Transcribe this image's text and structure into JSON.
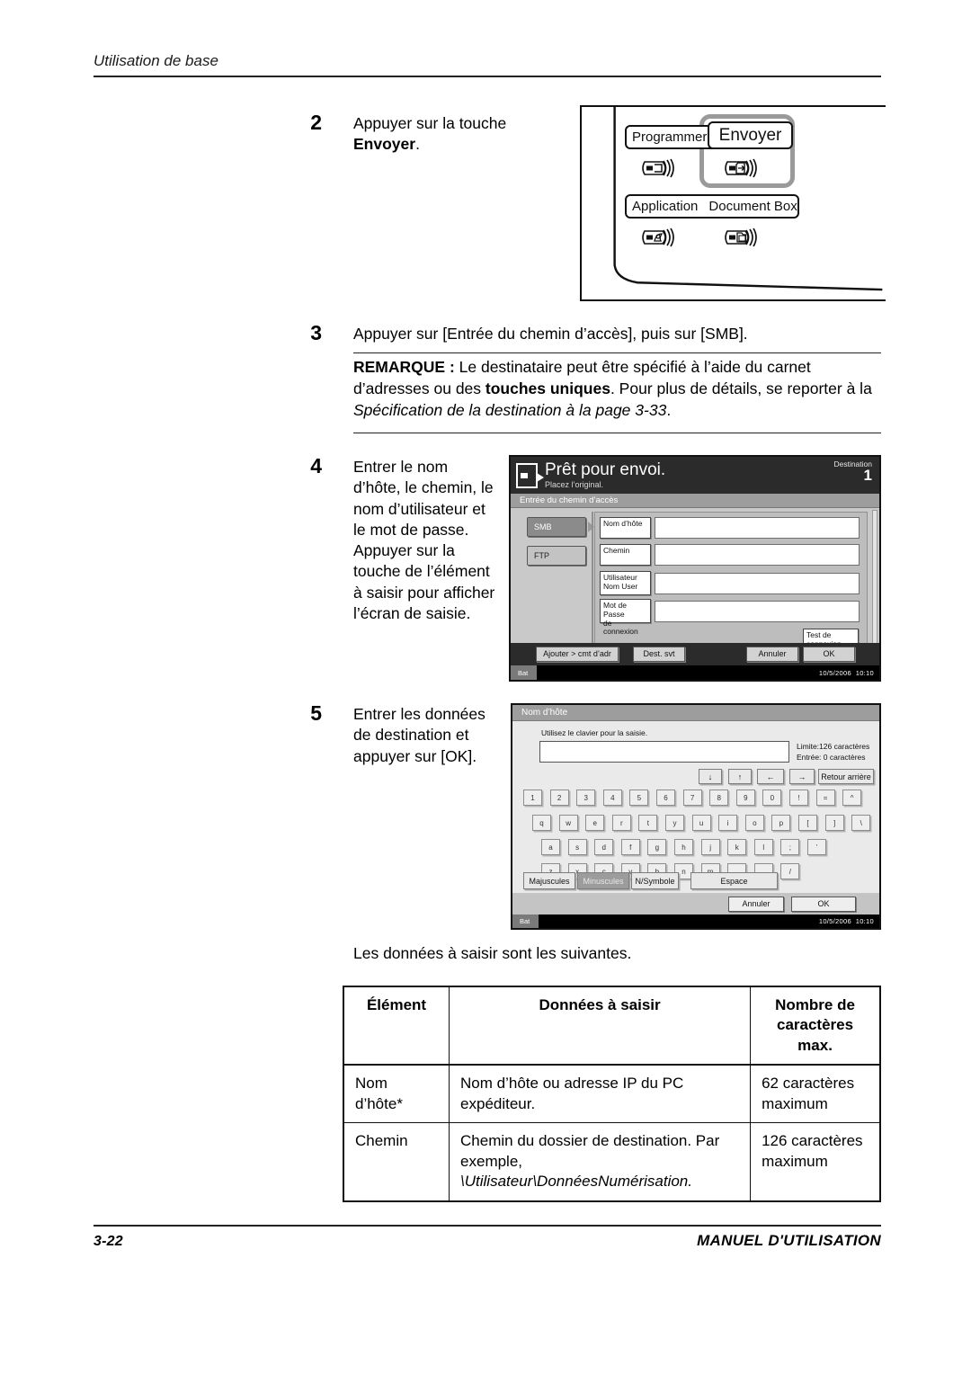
{
  "page": {
    "running_head": "Utilisation de base",
    "folio": "3-22",
    "manual_name": "MANUEL D'UTILISATION"
  },
  "steps": [
    {
      "number": "2",
      "line1": "Appuyer sur la touche",
      "line2_bold": "Envoyer",
      "line2_tail": "."
    },
    {
      "number": "3",
      "text": "Appuyer sur [Entrée du chemin d’accès], puis sur [SMB]."
    },
    {
      "number": "4",
      "text": "Entrer le nom d’hôte, le chemin, le nom d’utilisateur et le mot de passe. Appuyer sur la touche de l’élément à saisir pour afficher l’écran de saisie."
    },
    {
      "number": "5",
      "text": "Entrer les données de destination et appuyer sur [OK]."
    }
  ],
  "note": {
    "label": "REMARQUE :",
    "part1": " Le destinataire peut être spécifié à l’aide du carnet d’adresses ou des ",
    "bold1": "touches uniques",
    "part2": ". Pour plus de détails, se reporter à la ",
    "italic1": "Spécification de la destination à la page 3-33",
    "part3": "."
  },
  "op_panel": {
    "keys": [
      {
        "label": "Programmer",
        "icon": "program-key-icon"
      },
      {
        "label": "Envoyer",
        "icon": "send-key-icon"
      },
      {
        "label": "Application",
        "icon": "application-key-icon"
      },
      {
        "label": "Document Box",
        "icon": "document-box-key-icon"
      }
    ],
    "highlight": "Envoyer"
  },
  "screen_path": {
    "title": "Prêt pour envoi.",
    "subtitle": "Placez l’original.",
    "destination_label": "Destination",
    "destination_count": "1",
    "tabbar": "Entrée du chemin d’accès",
    "protocol_tabs": [
      {
        "label": "SMB",
        "selected": true
      },
      {
        "label": "FTP",
        "selected": false
      }
    ],
    "fields": [
      {
        "key_line1": "Nom d’hôte",
        "key_line2": "",
        "value": ""
      },
      {
        "key_line1": "Chemin",
        "key_line2": "",
        "value": ""
      },
      {
        "key_line1": "Utilisateur",
        "key_line2": "Nom User",
        "value": ""
      },
      {
        "key_line1": "Mot de Passe",
        "key_line2": "de connexion",
        "value": ""
      }
    ],
    "test_button_line1": "Test de",
    "test_button_line2": "connexion",
    "footer_buttons": [
      "Ajouter > cmt d’adr",
      "Dest. svt",
      "Annuler",
      "OK"
    ],
    "status_left": "Bat",
    "status_date": "10/5/2006",
    "status_time": "10:10"
  },
  "screen_keyboard": {
    "title": "Nom d’hôte",
    "hint": "Utilisez le clavier pour la saisie.",
    "input_value": "",
    "limit_line": "Limite:126 caractères",
    "entered_line": "Entrée: 0 caractères",
    "nav_keys": [
      "↓",
      "↑",
      "←",
      "→"
    ],
    "backspace_label": "Retour arrière",
    "rows": [
      [
        "1",
        "2",
        "3",
        "4",
        "5",
        "6",
        "7",
        "8",
        "9",
        "0",
        "!",
        "=",
        "^"
      ],
      [
        "q",
        "w",
        "e",
        "r",
        "t",
        "y",
        "u",
        "i",
        "o",
        "p",
        "[",
        "]",
        "\\"
      ],
      [
        "a",
        "s",
        "d",
        "f",
        "g",
        "h",
        "j",
        "k",
        "l",
        ";",
        "’"
      ],
      [
        "z",
        "x",
        "c",
        "v",
        "b",
        "n",
        "m",
        ",",
        ".",
        "/"
      ]
    ],
    "mode_buttons": [
      {
        "label": "Majuscules",
        "active": false
      },
      {
        "label": "Minuscules",
        "active": true
      },
      {
        "label": "N/Symbole",
        "active": false
      }
    ],
    "space_label": "Espace",
    "footer_buttons": [
      "Annuler",
      "OK"
    ],
    "status_left": "Bat",
    "status_date": "10/5/2006",
    "status_time": "10:10"
  },
  "lead_line": "Les données à saisir sont les suivantes.",
  "table": {
    "headers": [
      "Élément",
      "Données à saisir",
      "Nombre de\ncaractères max."
    ],
    "header_col3_line1": "Nombre de",
    "header_col3_line2": "caractères max.",
    "rows": [
      {
        "element": "Nom d’hôte*",
        "data_plain": "Nom d’hôte ou adresse IP du PC expéditeur.",
        "data_italic": "",
        "max": "62 caractères maximum"
      },
      {
        "element": "Chemin",
        "data_plain": "Chemin du dossier de destination. Par exemple,",
        "data_italic": "\\Utilisateur\\DonnéesNumérisation.",
        "max": "126 caractères maximum"
      }
    ]
  }
}
